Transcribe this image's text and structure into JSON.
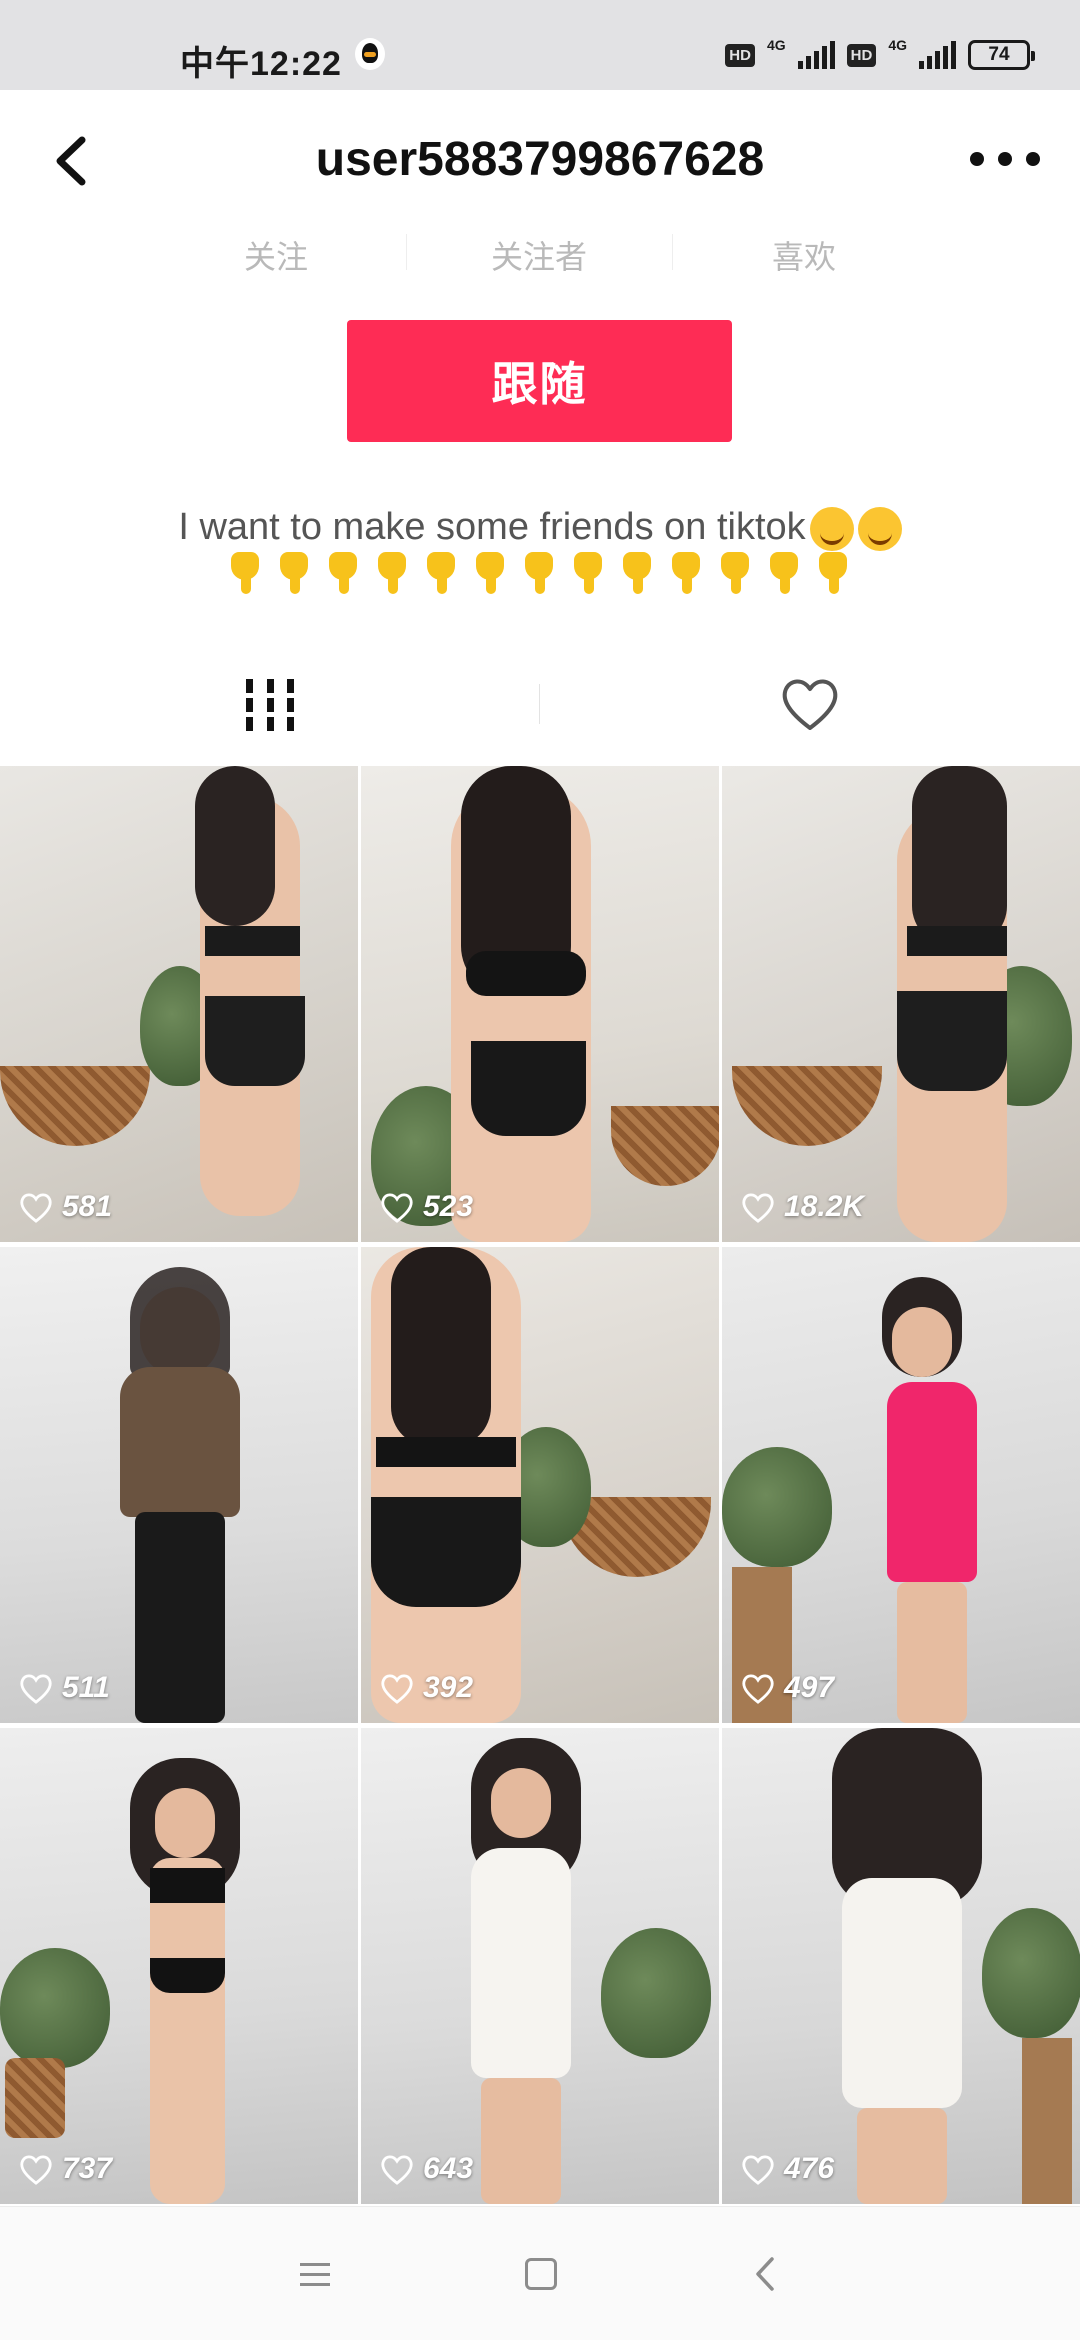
{
  "status_bar": {
    "time": "中午12:22",
    "hd1": "HD",
    "net1": "4G",
    "hd2": "HD",
    "net2": "4G",
    "battery": "74"
  },
  "header": {
    "title": "user5883799867628"
  },
  "stats": {
    "following": "关注",
    "followers": "关注者",
    "likes": "喜欢"
  },
  "follow_button": "跟随",
  "bio": {
    "text": "I want to make some friends on tiktok"
  },
  "videos": [
    {
      "likes": "581"
    },
    {
      "likes": "523"
    },
    {
      "likes": "18.2K"
    },
    {
      "likes": "511"
    },
    {
      "likes": "392"
    },
    {
      "likes": "497"
    },
    {
      "likes": "737"
    },
    {
      "likes": "643"
    },
    {
      "likes": "476"
    }
  ],
  "colors": {
    "follow_button": "#fe2c55",
    "status_bar_bg": "#e2e2e4"
  },
  "icons": {
    "back": "back-arrow-icon",
    "more": "more-dots-icon",
    "videos_tab": "grid-icon",
    "liked_tab": "heart-icon",
    "nav_menu": "menu-icon",
    "nav_home": "home-square-icon",
    "nav_back": "back-triangle-icon"
  }
}
